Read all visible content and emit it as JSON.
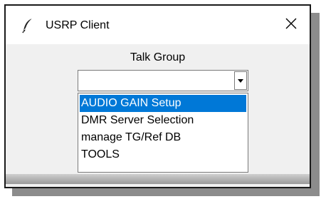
{
  "window": {
    "title": "USRP Client",
    "app_icon": "feather-icon",
    "close_icon": "close-icon"
  },
  "talk_group": {
    "label": "Talk Group",
    "value": "",
    "dropdown_icon": "chevron-down-icon",
    "options": [
      {
        "label": "AUDIO GAIN Setup",
        "selected": true
      },
      {
        "label": "DMR Server Selection",
        "selected": false
      },
      {
        "label": "manage TG/Ref DB",
        "selected": false
      },
      {
        "label": "TOOLS",
        "selected": false
      }
    ]
  },
  "colors": {
    "selection": "#0078d7",
    "selection_text": "#ffffff",
    "client_bg": "#f0f0f0"
  }
}
